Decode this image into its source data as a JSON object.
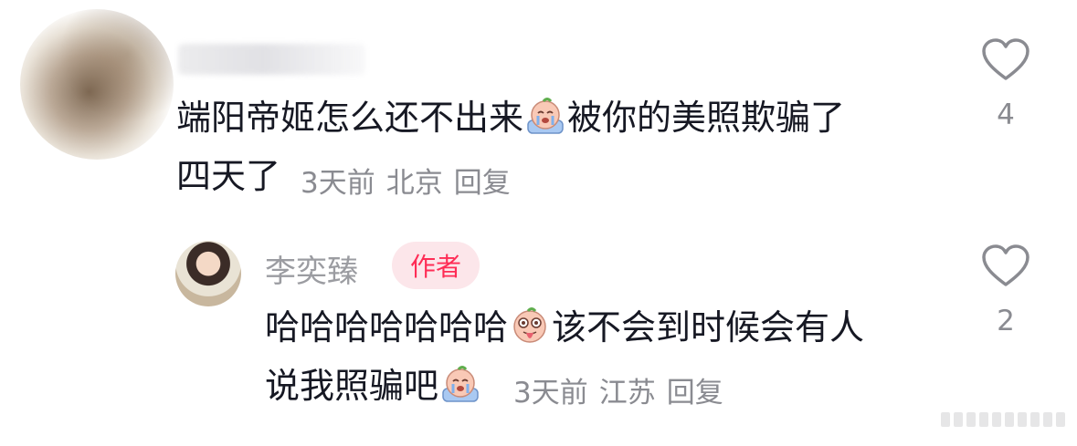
{
  "comments": [
    {
      "text_line1_a": "端阳帝姬怎么还不出来",
      "text_line1_b": "被你的美照欺骗了",
      "text_line2": "四天了",
      "time": "3天前",
      "location": "北京",
      "reply_label": "回复",
      "like_count": "4",
      "emoji": "crying-emoji"
    }
  ],
  "reply": {
    "username": "李奕臻",
    "badge": "作者",
    "text_line1_a": "哈哈哈哈哈哈哈",
    "text_line1_b": "该不会到时候会有人",
    "text_line2": "说我照骗吧",
    "time": "3天前",
    "location": "江苏",
    "reply_label": "回复",
    "like_count": "2",
    "emojis": [
      "tongue-out-emoji",
      "crying-emoji"
    ]
  },
  "colors": {
    "text": "#161823",
    "meta": "#8a8b91",
    "username": "#9b9ca1",
    "author_badge_bg": "#fce6ea",
    "author_badge_text": "#fe2c55"
  }
}
